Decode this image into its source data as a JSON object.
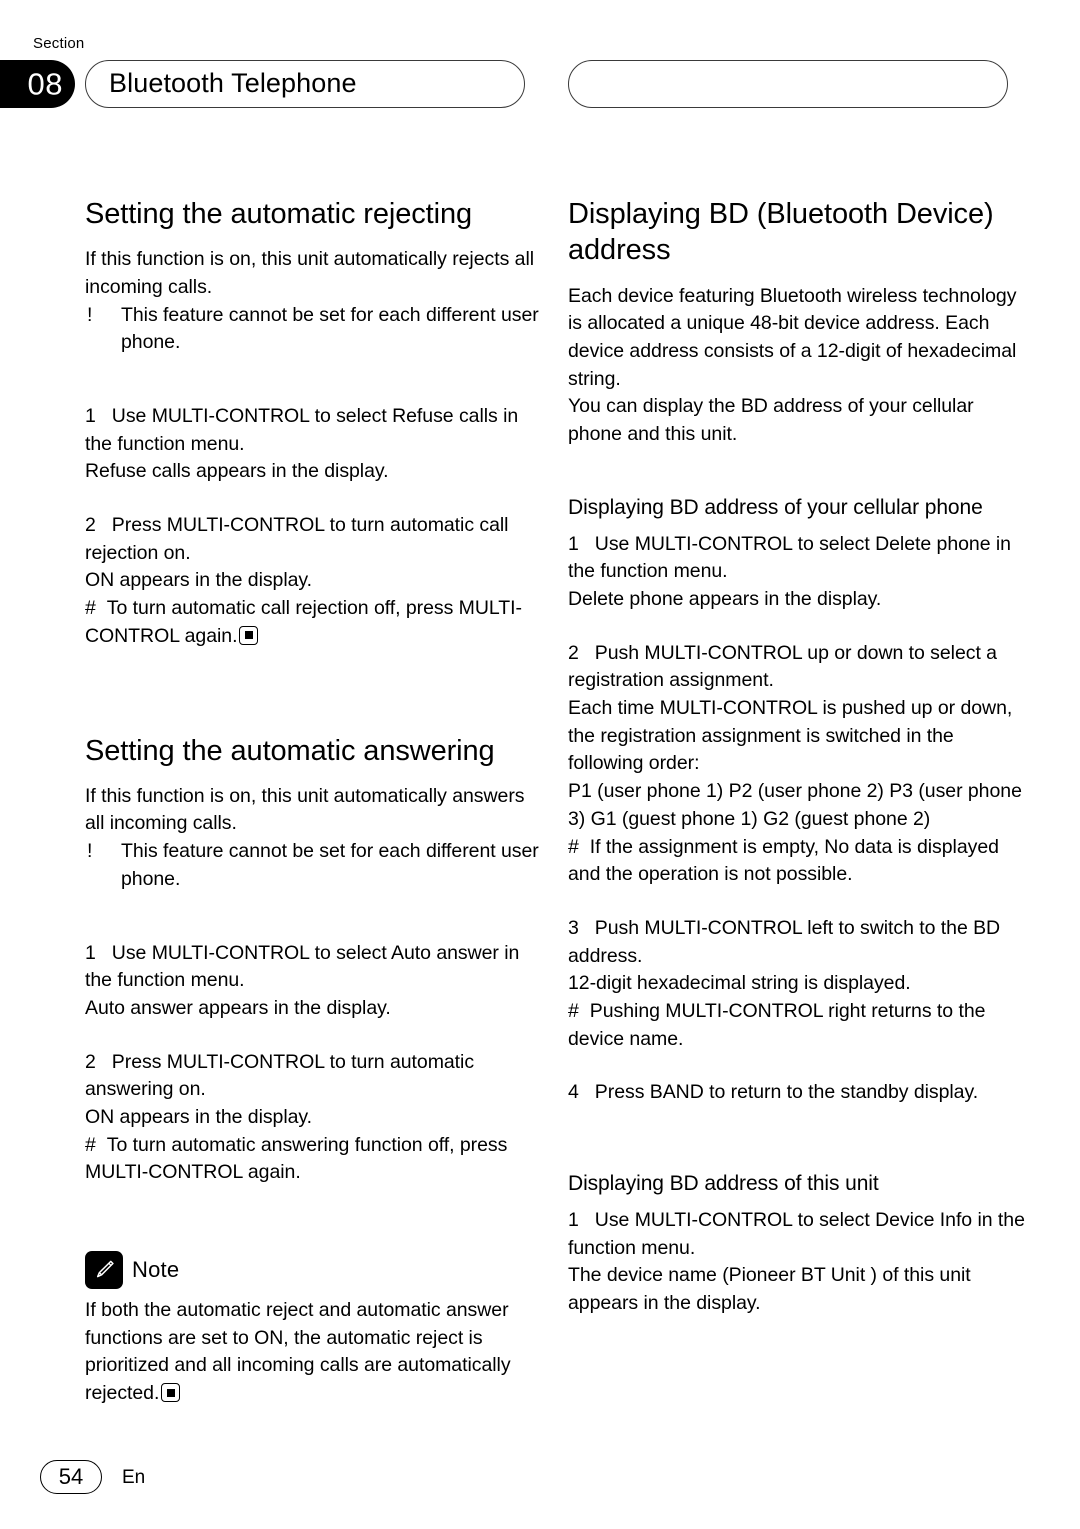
{
  "header": {
    "section_word": "Section",
    "section_number": "08",
    "section_title": "Bluetooth Telephone",
    "right_pill_text": ""
  },
  "left_column": {
    "section1": {
      "title": "Setting the automatic rejecting",
      "intro": "If this function is on, this unit automatically rejects all incoming calls.",
      "bullet_mark": "!",
      "bullet": "This feature cannot be set for each different user phone.",
      "step1_num": "1",
      "step1_text": "Use MULTI-CONTROL to select Refuse calls in the function menu.",
      "step1_result": "Refuse calls appears in the display.",
      "step2_num": "2",
      "step2_text": "Press MULTI-CONTROL to turn automatic call rejection on.",
      "step2_result": "ON appears in the display.",
      "hash_mark": "#",
      "step2_note": "To turn automatic call rejection off, press MULTI-CONTROL again."
    },
    "section2": {
      "title": "Setting the automatic answering",
      "intro": "If this function is on, this unit automatically answers all incoming calls.",
      "bullet_mark": "!",
      "bullet": "This feature cannot be set for each different user phone.",
      "step1_num": "1",
      "step1_text": "Use MULTI-CONTROL to select Auto answer in the function menu.",
      "step1_result": "Auto answer  appears in the display.",
      "step2_num": "2",
      "step2_text": "Press MULTI-CONTROL to turn automatic answering on.",
      "step2_result": "ON appears in the display.",
      "hash_mark": "#",
      "step2_note": "To turn automatic answering function off, press MULTI-CONTROL again."
    },
    "note": {
      "icon": "pencil-icon",
      "label": "Note",
      "text": "If both the automatic reject and automatic answer functions are set to ON, the automatic reject is prioritized and all incoming calls are automatically rejected."
    }
  },
  "right_column": {
    "section1": {
      "title": "Displaying BD (Bluetooth Device) address",
      "para1": "Each device featuring Bluetooth wireless technology is allocated a unique 48-bit device address. Each device address consists of a 12-digit of hexadecimal string.",
      "para2": "You can display the BD address of your cellular phone and this unit."
    },
    "sub1": {
      "title": "Displaying BD address of your cellular phone",
      "step1_num": "1",
      "step1_text": "Use MULTI-CONTROL to select Delete phone in the function menu.",
      "step1_result": "Delete phone  appears in the display.",
      "step2_num": "2",
      "step2_text": "Push MULTI-CONTROL up or down to select a registration assignment.",
      "step2_result": "Each time MULTI-CONTROL is pushed up or down, the registration assignment is switched in the following order:",
      "order_list": "P1 (user phone 1)   P2 (user phone 2)   P3 (user phone 3)   G1 (guest phone 1)   G2 (guest phone 2)",
      "hash_mark": "#",
      "step2_note": "If the assignment is empty, No data  is displayed and the operation is not possible.",
      "step3_num": "3",
      "step3_text": "Push MULTI-CONTROL left to switch to the BD address.",
      "step3_result": "12-digit hexadecimal string is displayed.",
      "step3_note": "Pushing MULTI-CONTROL right returns to the device name.",
      "step4_num": "4",
      "step4_text": "Press BAND to return to the standby display."
    },
    "sub2": {
      "title": "Displaying BD address of this unit",
      "step1_num": "1",
      "step1_text": "Use MULTI-CONTROL to select Device Info in the function menu.",
      "step1_result": "The device name (Pioneer BT Unit ) of this unit appears in the display."
    }
  },
  "footer": {
    "page_number": "54",
    "language_code": "En"
  }
}
